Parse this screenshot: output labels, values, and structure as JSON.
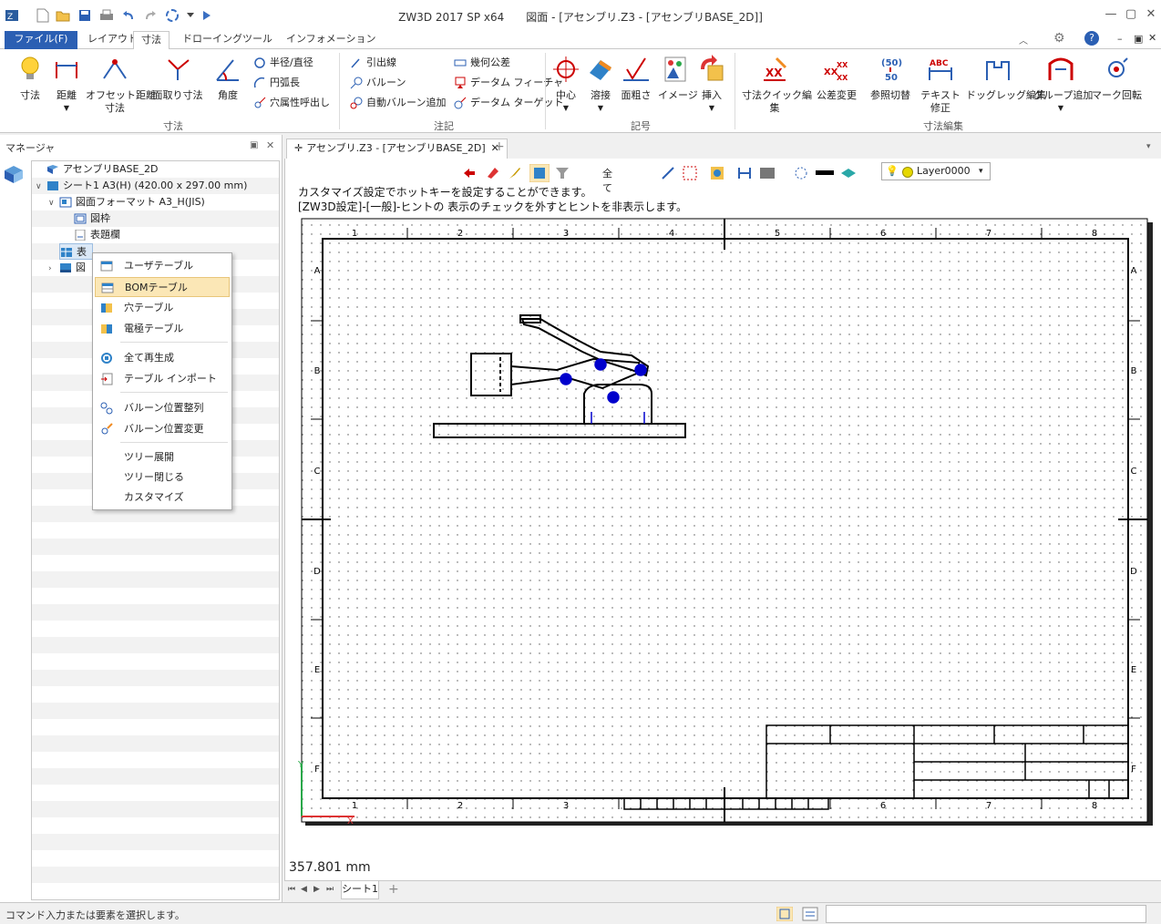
{
  "app": {
    "title": "ZW3D 2017 SP x64　　図面 - [アセンブリ.Z3 - [アセンブリBASE_2D]]"
  },
  "ribbon_tabs": [
    {
      "label": "ファイル(F)"
    },
    {
      "label": "レイアウト"
    },
    {
      "label": "寸法"
    },
    {
      "label": "ドローイング"
    },
    {
      "label": "ツール"
    },
    {
      "label": "インフォメーション"
    }
  ],
  "ribbon": {
    "dim_group": {
      "label": "寸法",
      "buttons": [
        "寸法",
        "距離",
        "オフセット距離\n寸法",
        "面取り寸法",
        "角度"
      ],
      "small": [
        "半径/直径",
        "円弧長",
        "穴属性呼出し"
      ]
    },
    "note_group": {
      "label": "注記",
      "small": [
        "引出線",
        "バルーン",
        "自動バルーン追加",
        "幾何公差",
        "データム フィーチャ",
        "データム ターゲット"
      ]
    },
    "symbol_group": {
      "label": "記号",
      "buttons": [
        "中心",
        "溶接",
        "面粗さ",
        "イメージ",
        "挿入"
      ]
    },
    "dimedit_group": {
      "label": "寸法編集",
      "buttons": [
        "寸法クイック編\n集",
        "公差変更",
        "参照切替",
        "テキスト\n修正",
        "ドッグレッグ編集",
        "グループ追加",
        "マーク回転"
      ]
    }
  },
  "manager": {
    "title": "マネージャ",
    "tree": [
      {
        "label": "アセンブリBASE_2D",
        "level": 0
      },
      {
        "label": "シート1 A3(H) (420.00 x 297.00 mm)",
        "level": 1
      },
      {
        "label": "図面フォーマット A3_H(JIS)",
        "level": 2
      },
      {
        "label": "図枠",
        "level": 3
      },
      {
        "label": "表題欄",
        "level": 3
      },
      {
        "label": "表",
        "level": 2
      },
      {
        "label": "図",
        "level": 2
      }
    ]
  },
  "context_menu": {
    "items": [
      "ユーザテーブル",
      "BOMテーブル",
      "穴テーブル",
      "電極テーブル",
      "全て再生成",
      "テーブル インポート",
      "バルーン位置整列",
      "バルーン位置変更",
      "ツリー展開",
      "ツリー閉じる",
      "カスタマイズ"
    ]
  },
  "document": {
    "tab_label": "アセンブリ.Z3 - [アセンブリBASE_2D]",
    "filter_label": "全て",
    "layer": "Layer0000",
    "hint_line1": "カスタマイズ設定でホットキーを設定することができます。",
    "hint_line2": "[ZW3D設定]-[一般]-ヒントの 表示のチェックを外すとヒントを非表示します。",
    "coordinate": "357.801 mm",
    "sheet_tab": "シート1",
    "col_labels": [
      "1",
      "2",
      "3",
      "4",
      "5",
      "6",
      "7",
      "8"
    ],
    "row_labels": [
      "A",
      "B",
      "C",
      "D",
      "E",
      "F"
    ]
  },
  "status": {
    "text": "コマンド入力または要素を選択します。"
  },
  "colors": {
    "file_tab": "#2b5fb3",
    "menu_highlight": "#fbe7b6",
    "drawing_line": "#000000",
    "hole_marker": "#0000cc"
  }
}
